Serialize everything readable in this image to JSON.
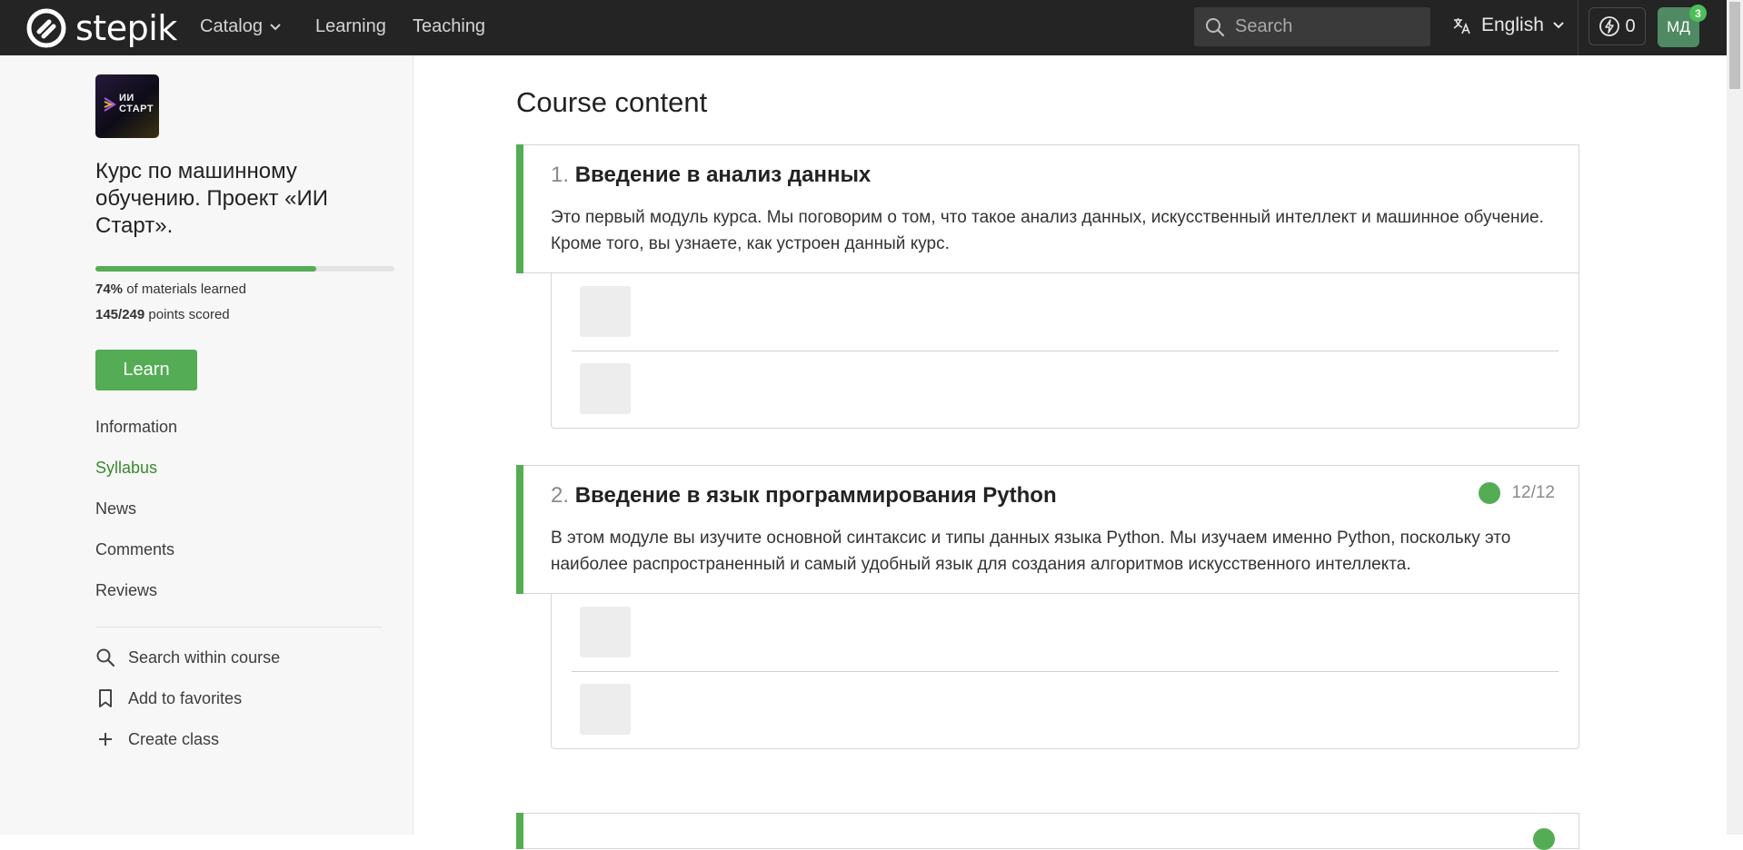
{
  "topbar": {
    "brand": "stepik",
    "nav": {
      "catalog": "Catalog",
      "learning": "Learning",
      "teaching": "Teaching"
    },
    "search_placeholder": "Search",
    "language": "English",
    "energy_count": "0",
    "avatar_initials": "МД",
    "notifications_count": "3",
    "colors": {
      "bar": "#242424",
      "avatar": "#4f8a63",
      "badge": "#4bbf5a"
    }
  },
  "sidebar": {
    "course_image_text": "ИИ\nСТАРТ",
    "course_title": "Курс по машинному обучению. Проект «ИИ Старт».",
    "progress_fraction": 0.74,
    "materials_percent": "74%",
    "materials_label": "of materials learned",
    "points": "145/249",
    "points_label": "points scored",
    "learn_label": "Learn",
    "links": {
      "information": "Information",
      "syllabus": "Syllabus",
      "news": "News",
      "comments": "Comments",
      "reviews": "Reviews"
    },
    "actions": {
      "search": "Search within course",
      "favorites": "Add to favorites",
      "create_class": "Create class"
    },
    "active_link": "Syllabus",
    "accent_color": "#54ad54"
  },
  "main": {
    "title": "Course content",
    "modules": [
      {
        "number": "1.",
        "title": "Введение в анализ данных",
        "description": "Это первый модуль курса. Мы поговорим о том, что такое анализ данных, искусственный интеллект и машинное обучение. Кроме того, вы узнаете, как устроен данный курс.",
        "progress": ""
      },
      {
        "number": "2.",
        "title": "Введение в язык программирования Python",
        "description": "В этом модуле вы изучите основной синтаксис и типы данных языка Python. Мы изучаем именно Python, поскольку это наиболее распространенный и самый удобный язык для создания алгоритмов искусственного интеллекта.",
        "progress": "12/12"
      }
    ]
  }
}
